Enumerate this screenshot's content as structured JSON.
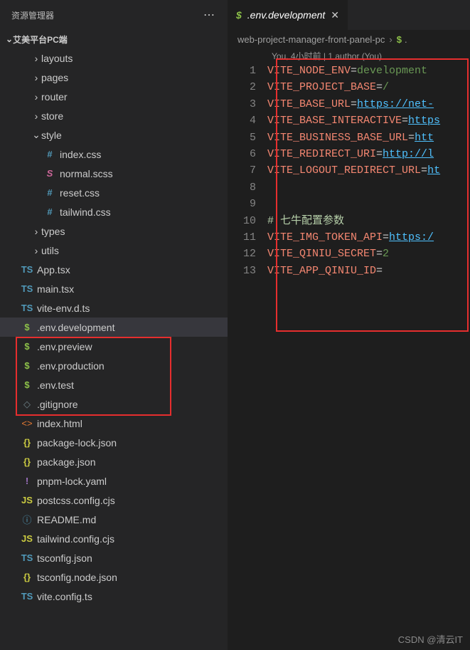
{
  "sidebar": {
    "title": "资源管理器",
    "projectName": "艾美平台PC端"
  },
  "tree": [
    {
      "indent": 1,
      "type": "folder",
      "open": false,
      "name": "layouts"
    },
    {
      "indent": 1,
      "type": "folder",
      "open": false,
      "name": "pages"
    },
    {
      "indent": 1,
      "type": "folder",
      "open": false,
      "name": "router"
    },
    {
      "indent": 1,
      "type": "folder",
      "open": false,
      "name": "store"
    },
    {
      "indent": 1,
      "type": "folder",
      "open": true,
      "name": "style"
    },
    {
      "indent": 2,
      "type": "file",
      "icon": "hash",
      "name": "index.css"
    },
    {
      "indent": 2,
      "type": "file",
      "icon": "sass",
      "name": "normal.scss"
    },
    {
      "indent": 2,
      "type": "file",
      "icon": "hash",
      "name": "reset.css"
    },
    {
      "indent": 2,
      "type": "file",
      "icon": "hash",
      "name": "tailwind.css"
    },
    {
      "indent": 1,
      "type": "folder",
      "open": false,
      "name": "types"
    },
    {
      "indent": 1,
      "type": "folder",
      "open": false,
      "name": "utils"
    },
    {
      "indent": 0,
      "type": "file",
      "icon": "ts",
      "name": "App.tsx"
    },
    {
      "indent": 0,
      "type": "file",
      "icon": "ts",
      "name": "main.tsx"
    },
    {
      "indent": 0,
      "type": "file",
      "icon": "ts",
      "name": "vite-env.d.ts"
    },
    {
      "indent": 0,
      "type": "file",
      "icon": "dollar",
      "name": ".env.development",
      "active": true
    },
    {
      "indent": 0,
      "type": "file",
      "icon": "dollar",
      "name": ".env.preview"
    },
    {
      "indent": 0,
      "type": "file",
      "icon": "dollar",
      "name": ".env.production"
    },
    {
      "indent": 0,
      "type": "file",
      "icon": "dollar",
      "name": ".env.test"
    },
    {
      "indent": 0,
      "type": "file",
      "icon": "ignore",
      "name": ".gitignore"
    },
    {
      "indent": 0,
      "type": "file",
      "icon": "html",
      "name": "index.html"
    },
    {
      "indent": 0,
      "type": "file",
      "icon": "json",
      "name": "package-lock.json"
    },
    {
      "indent": 0,
      "type": "file",
      "icon": "json",
      "name": "package.json"
    },
    {
      "indent": 0,
      "type": "file",
      "icon": "exclaim",
      "name": "pnpm-lock.yaml"
    },
    {
      "indent": 0,
      "type": "file",
      "icon": "js",
      "name": "postcss.config.cjs"
    },
    {
      "indent": 0,
      "type": "file",
      "icon": "info",
      "name": "README.md"
    },
    {
      "indent": 0,
      "type": "file",
      "icon": "js",
      "name": "tailwind.config.cjs"
    },
    {
      "indent": 0,
      "type": "file",
      "icon": "tsconfig",
      "name": "tsconfig.json"
    },
    {
      "indent": 0,
      "type": "file",
      "icon": "json",
      "name": "tsconfig.node.json"
    },
    {
      "indent": 0,
      "type": "file",
      "icon": "ts",
      "name": "vite.config.ts"
    }
  ],
  "tab": {
    "label": ".env.development"
  },
  "breadcrumb": {
    "segments": [
      "web-project-manager-front-panel-pc",
      "."
    ],
    "fileIcon": "dollar"
  },
  "codelens": "You, 4小时前 | 1 author (You)",
  "code": [
    {
      "n": 1,
      "key": "VITE_NODE_ENV",
      "val": "development",
      "valType": "val"
    },
    {
      "n": 2,
      "key": "VITE_PROJECT_BASE",
      "val": "/",
      "valType": "val"
    },
    {
      "n": 3,
      "key": "VITE_BASE_URL",
      "val": "https://net-",
      "valType": "url"
    },
    {
      "n": 4,
      "key": "VITE_BASE_INTERACTIVE",
      "val": "https",
      "valType": "url"
    },
    {
      "n": 5,
      "key": "VITE_BUSINESS_BASE_URL",
      "val": "htt",
      "valType": "url"
    },
    {
      "n": 6,
      "key": "VITE_REDIRECT_URI",
      "val": "http://l",
      "valType": "url"
    },
    {
      "n": 7,
      "key": "VITE_LOGOUT_REDIRECT_URL",
      "val": "ht",
      "valType": "url"
    },
    {
      "n": 8,
      "blank": true
    },
    {
      "n": 9,
      "blank": true
    },
    {
      "n": 10,
      "comment": "# 七牛配置参数"
    },
    {
      "n": 11,
      "key": "VITE_IMG_TOKEN_API",
      "val": "https:/",
      "valType": "url"
    },
    {
      "n": 12,
      "key": "VITE_QINIU_SECRET",
      "val": "2",
      "valType": "val",
      "obscured": true
    },
    {
      "n": 13,
      "key": "VITE_APP_QINIU_ID",
      "val": "",
      "valType": "val",
      "obscured": true
    }
  ],
  "watermark": "CSDN @清云IT"
}
